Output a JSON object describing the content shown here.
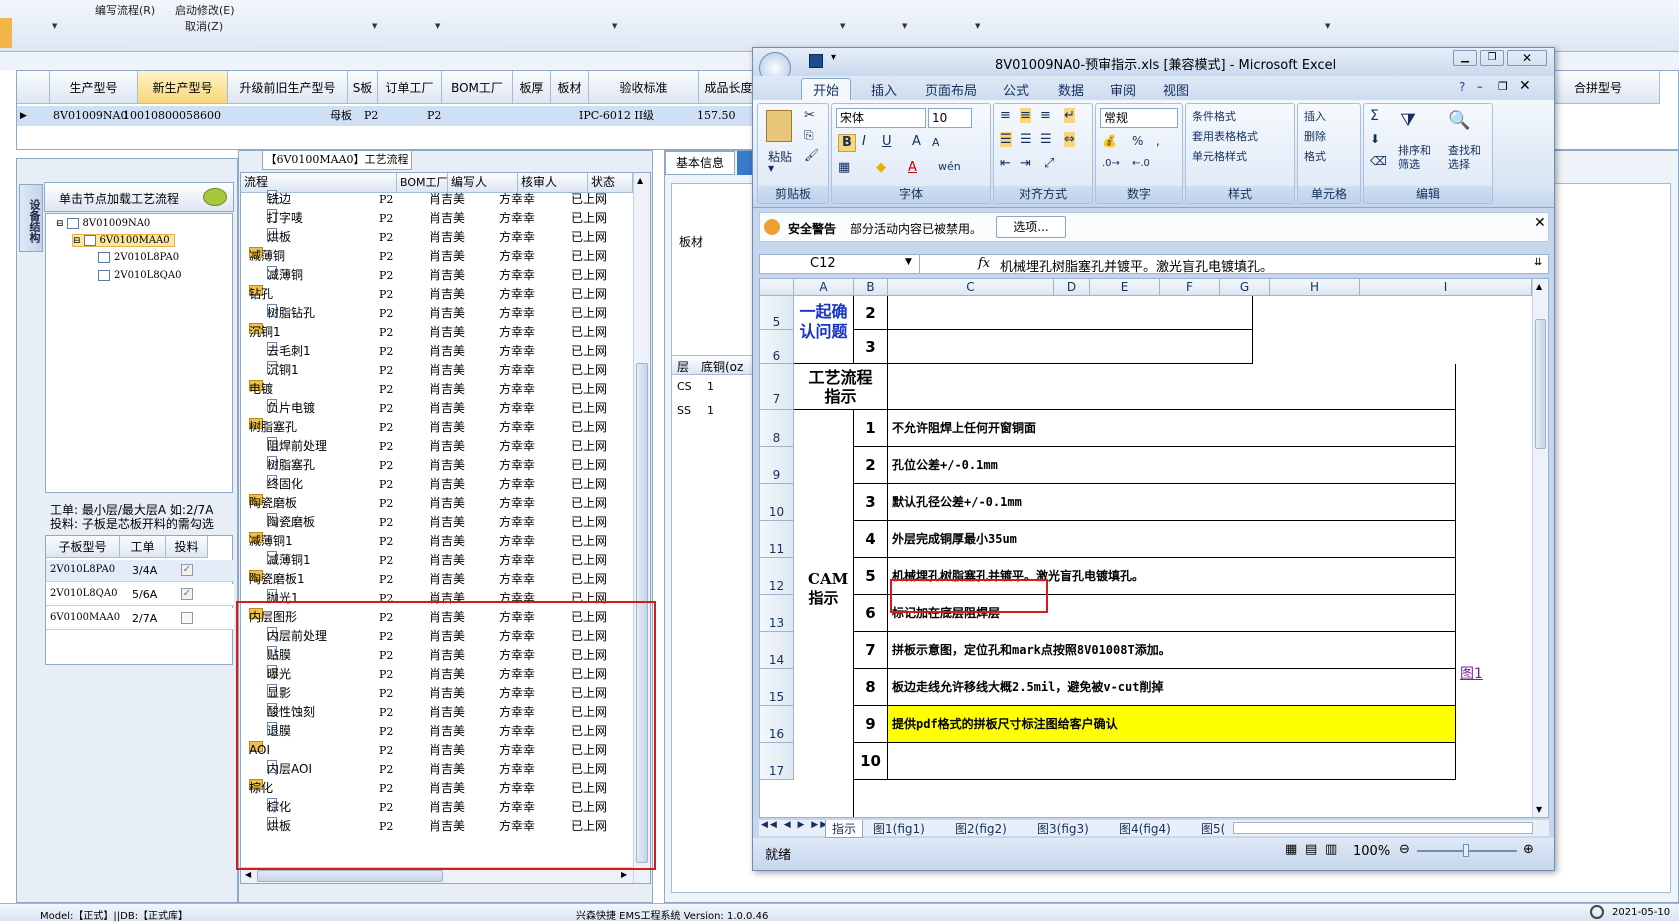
{
  "app_menu": {
    "edit_flow": "编写流程(R)",
    "start_modify": "启动修改(E)",
    "cancel": "取消(Z)"
  },
  "main_grid": {
    "headers": [
      "生产型号",
      "新生产型号",
      "升级前旧生产型号",
      "S板",
      "订单工厂",
      "BOM工厂",
      "板厚",
      "板材",
      "验收标准",
      "成品长度",
      "合拼型号"
    ],
    "row": {
      "prod_no": "8V01009NA0",
      "new_prod_no": "10010800058600",
      "s_board": "母板",
      "order_factory": "P2",
      "bom_factory": "P2",
      "standard": "IPC-6012 II级",
      "length": "157.50"
    }
  },
  "left_panel": {
    "vertical_tab": "设备结构",
    "node_header": "单击节点加载工艺流程",
    "tree": [
      {
        "label": "8V01009NA0",
        "level": 0
      },
      {
        "label": "6V0100MAA0",
        "level": 1,
        "selected": true
      },
      {
        "label": "2V010L8PA0",
        "level": 2
      },
      {
        "label": "2V010L8QA0",
        "level": 2
      }
    ],
    "note1": "工单: 最小层/最大层A 如:2/7A",
    "note2": "投料: 子板是芯板开料的需勾选",
    "subtable_headers": [
      "子板型号",
      "工单",
      "投料"
    ],
    "subtable_rows": [
      {
        "model": "2V010L8PA0",
        "order": "3/4A",
        "checked": true
      },
      {
        "model": "2V010L8QA0",
        "order": "5/6A",
        "checked": true
      },
      {
        "model": "6V0100MAA0",
        "order": "2/7A",
        "checked": false
      }
    ]
  },
  "flow_panel": {
    "title": "【6V0100MAA0】工艺流程",
    "headers": [
      "流程",
      "BOM工厂",
      "编写人",
      "核审人",
      "状态"
    ],
    "rows": [
      {
        "name": "铣边",
        "type": "doc",
        "bom": "P2",
        "writer": "肖吉美",
        "reviewer": "方幸幸",
        "status": "已上网"
      },
      {
        "name": "打字唛",
        "type": "doc",
        "bom": "P2",
        "writer": "肖吉美",
        "reviewer": "方幸幸",
        "status": "已上网"
      },
      {
        "name": "烘板",
        "type": "doc",
        "bom": "P2",
        "writer": "肖吉美",
        "reviewer": "方幸幸",
        "status": "已上网"
      },
      {
        "name": "减薄铜",
        "type": "folder",
        "bom": "P2",
        "writer": "肖吉美",
        "reviewer": "方幸幸",
        "status": "已上网"
      },
      {
        "name": "减薄铜",
        "type": "doc",
        "bom": "P2",
        "writer": "肖吉美",
        "reviewer": "方幸幸",
        "status": "已上网"
      },
      {
        "name": "钻孔",
        "type": "folder",
        "bom": "P2",
        "writer": "肖吉美",
        "reviewer": "方幸幸",
        "status": "已上网"
      },
      {
        "name": "树脂钻孔",
        "type": "doc",
        "bom": "P2",
        "writer": "肖吉美",
        "reviewer": "方幸幸",
        "status": "已上网"
      },
      {
        "name": "沉铜1",
        "type": "folder",
        "bom": "P2",
        "writer": "肖吉美",
        "reviewer": "方幸幸",
        "status": "已上网"
      },
      {
        "name": "去毛刺1",
        "type": "doc",
        "bom": "P2",
        "writer": "肖吉美",
        "reviewer": "方幸幸",
        "status": "已上网"
      },
      {
        "name": "沉铜1",
        "type": "doc",
        "bom": "P2",
        "writer": "肖吉美",
        "reviewer": "方幸幸",
        "status": "已上网"
      },
      {
        "name": "电镀",
        "type": "folder",
        "bom": "P2",
        "writer": "肖吉美",
        "reviewer": "方幸幸",
        "status": "已上网"
      },
      {
        "name": "负片电镀",
        "type": "doc",
        "bom": "P2",
        "writer": "肖吉美",
        "reviewer": "方幸幸",
        "status": "已上网"
      },
      {
        "name": "树脂塞孔",
        "type": "folder",
        "bom": "P2",
        "writer": "肖吉美",
        "reviewer": "方幸幸",
        "status": "已上网"
      },
      {
        "name": "阻焊前处理",
        "type": "doc",
        "bom": "P2",
        "writer": "肖吉美",
        "reviewer": "方幸幸",
        "status": "已上网"
      },
      {
        "name": "树脂塞孔",
        "type": "doc",
        "bom": "P2",
        "writer": "肖吉美",
        "reviewer": "方幸幸",
        "status": "已上网"
      },
      {
        "name": "终固化",
        "type": "doc",
        "bom": "P2",
        "writer": "肖吉美",
        "reviewer": "方幸幸",
        "status": "已上网"
      },
      {
        "name": "陶瓷磨板",
        "type": "folder",
        "bom": "P2",
        "writer": "肖吉美",
        "reviewer": "方幸幸",
        "status": "已上网"
      },
      {
        "name": "陶瓷磨板",
        "type": "doc",
        "bom": "P2",
        "writer": "肖吉美",
        "reviewer": "方幸幸",
        "status": "已上网"
      },
      {
        "name": "减薄铜1",
        "type": "folder",
        "bom": "P2",
        "writer": "肖吉美",
        "reviewer": "方幸幸",
        "status": "已上网"
      },
      {
        "name": "减薄铜1",
        "type": "doc",
        "bom": "P2",
        "writer": "肖吉美",
        "reviewer": "方幸幸",
        "status": "已上网"
      },
      {
        "name": "陶瓷磨板1",
        "type": "folder",
        "bom": "P2",
        "writer": "肖吉美",
        "reviewer": "方幸幸",
        "status": "已上网"
      },
      {
        "name": "抛光1",
        "type": "doc",
        "bom": "P2",
        "writer": "肖吉美",
        "reviewer": "方幸幸",
        "status": "已上网"
      },
      {
        "name": "内层图形",
        "type": "folder",
        "bom": "P2",
        "writer": "肖吉美",
        "reviewer": "方幸幸",
        "status": "已上网"
      },
      {
        "name": "内层前处理",
        "type": "doc",
        "bom": "P2",
        "writer": "肖吉美",
        "reviewer": "方幸幸",
        "status": "已上网"
      },
      {
        "name": "贴膜",
        "type": "doc",
        "bom": "P2",
        "writer": "肖吉美",
        "reviewer": "方幸幸",
        "status": "已上网"
      },
      {
        "name": "曝光",
        "type": "doc",
        "bom": "P2",
        "writer": "肖吉美",
        "reviewer": "方幸幸",
        "status": "已上网"
      },
      {
        "name": "显影",
        "type": "doc",
        "bom": "P2",
        "writer": "肖吉美",
        "reviewer": "方幸幸",
        "status": "已上网"
      },
      {
        "name": "酸性蚀刻",
        "type": "doc",
        "bom": "P2",
        "writer": "肖吉美",
        "reviewer": "方幸幸",
        "status": "已上网"
      },
      {
        "name": "退膜",
        "type": "doc",
        "bom": "P2",
        "writer": "肖吉美",
        "reviewer": "方幸幸",
        "status": "已上网"
      },
      {
        "name": "AOI",
        "type": "folder",
        "bom": "P2",
        "writer": "肖吉美",
        "reviewer": "方幸幸",
        "status": "已上网"
      },
      {
        "name": "内层AOI",
        "type": "doc",
        "bom": "P2",
        "writer": "肖吉美",
        "reviewer": "方幸幸",
        "status": "已上网"
      },
      {
        "name": "棕化",
        "type": "folder",
        "bom": "P2",
        "writer": "肖吉美",
        "reviewer": "方幸幸",
        "status": "已上网"
      },
      {
        "name": "棕化",
        "type": "doc",
        "bom": "P2",
        "writer": "肖吉美",
        "reviewer": "方幸幸",
        "status": "已上网"
      },
      {
        "name": "烘板",
        "type": "doc",
        "bom": "P2",
        "writer": "肖吉美",
        "reviewer": "方幸幸",
        "status": "已上网"
      }
    ]
  },
  "right_panel": {
    "tab_basic": "基本信息",
    "board_label": "板材",
    "layer_header": "层",
    "base_copper_header": "底铜(oz",
    "layers": [
      {
        "name": "CS",
        "value": "1"
      },
      {
        "name": "SS",
        "value": "1"
      }
    ]
  },
  "excel": {
    "title": "8V01009NA0-预审指示.xls  [兼容模式] - Microsoft Excel",
    "tabs": [
      "开始",
      "插入",
      "页面布局",
      "公式",
      "数据",
      "审阅",
      "视图"
    ],
    "groups": {
      "clipboard": {
        "label": "剪贴板",
        "paste": "粘贴"
      },
      "font": {
        "label": "字体",
        "name": "宋体",
        "size": "10"
      },
      "align": {
        "label": "对齐方式"
      },
      "number": {
        "label": "数字",
        "format": "常规"
      },
      "styles": {
        "label": "样式",
        "cond": "条件格式",
        "table": "套用表格格式",
        "cell": "单元格样式"
      },
      "cells": {
        "label": "单元格",
        "insert": "插入",
        "delete": "删除",
        "format": "格式"
      },
      "editing": {
        "label": "编辑",
        "sort": "排序和\n筛选",
        "find": "查找和\n选择"
      }
    },
    "warning": {
      "title": "安全警告",
      "text": "部分活动内容已被禁用。",
      "button": "选项..."
    },
    "name_box": "C12",
    "formula": "机械埋孔树脂塞孔并镀平。激光盲孔电镀填孔。",
    "columns": [
      "A",
      "B",
      "C",
      "D",
      "E",
      "F",
      "G",
      "H",
      "I"
    ],
    "rows": [
      {
        "num": "5",
        "b": "2",
        "c": ""
      },
      {
        "num": "6",
        "b": "3",
        "c": ""
      },
      {
        "num": "7",
        "b": "",
        "c": ""
      },
      {
        "num": "8",
        "b": "1",
        "c": "不允许阻焊上任何开窗铜面"
      },
      {
        "num": "9",
        "b": "2",
        "c": "孔位公差+/-0.1mm"
      },
      {
        "num": "10",
        "b": "3",
        "c": "默认孔径公差+/-0.1mm"
      },
      {
        "num": "11",
        "b": "4",
        "c": "外层完成铜厚最小35um"
      },
      {
        "num": "12",
        "b": "5",
        "c": "机械埋孔树脂塞孔并镀平。激光盲孔电镀填孔。"
      },
      {
        "num": "13",
        "b": "6",
        "c": "标记加在底层阻焊层"
      },
      {
        "num": "14",
        "b": "7",
        "c": "拼板示意图，定位孔和mark点按照8V01008T添加。"
      },
      {
        "num": "15",
        "b": "8",
        "c": "板边走线允许移线大概2.5mil，避免被v-cut削掉"
      },
      {
        "num": "16",
        "b": "9",
        "c": "提供pdf格式的拼板尺寸标注图给客户确认"
      },
      {
        "num": "17",
        "b": "10",
        "c": ""
      }
    ],
    "merged": {
      "confirm": "一起确认问题",
      "flow": "工艺流程指示",
      "cam": "CAM指示"
    },
    "link_text": "图1",
    "sheet_tabs": [
      "指示",
      "图1(fig1)",
      "图2(fig2)",
      "图3(fig3)",
      "图4(fig4)",
      "图5("
    ],
    "status_ready": "就绪",
    "zoom": "100%"
  },
  "status_bar": {
    "model": "Model:【正式】||DB:【正式库】",
    "system": "兴森快捷 EMS工程系统 Version: 1.0.0.46",
    "date": "2021-05-10"
  }
}
